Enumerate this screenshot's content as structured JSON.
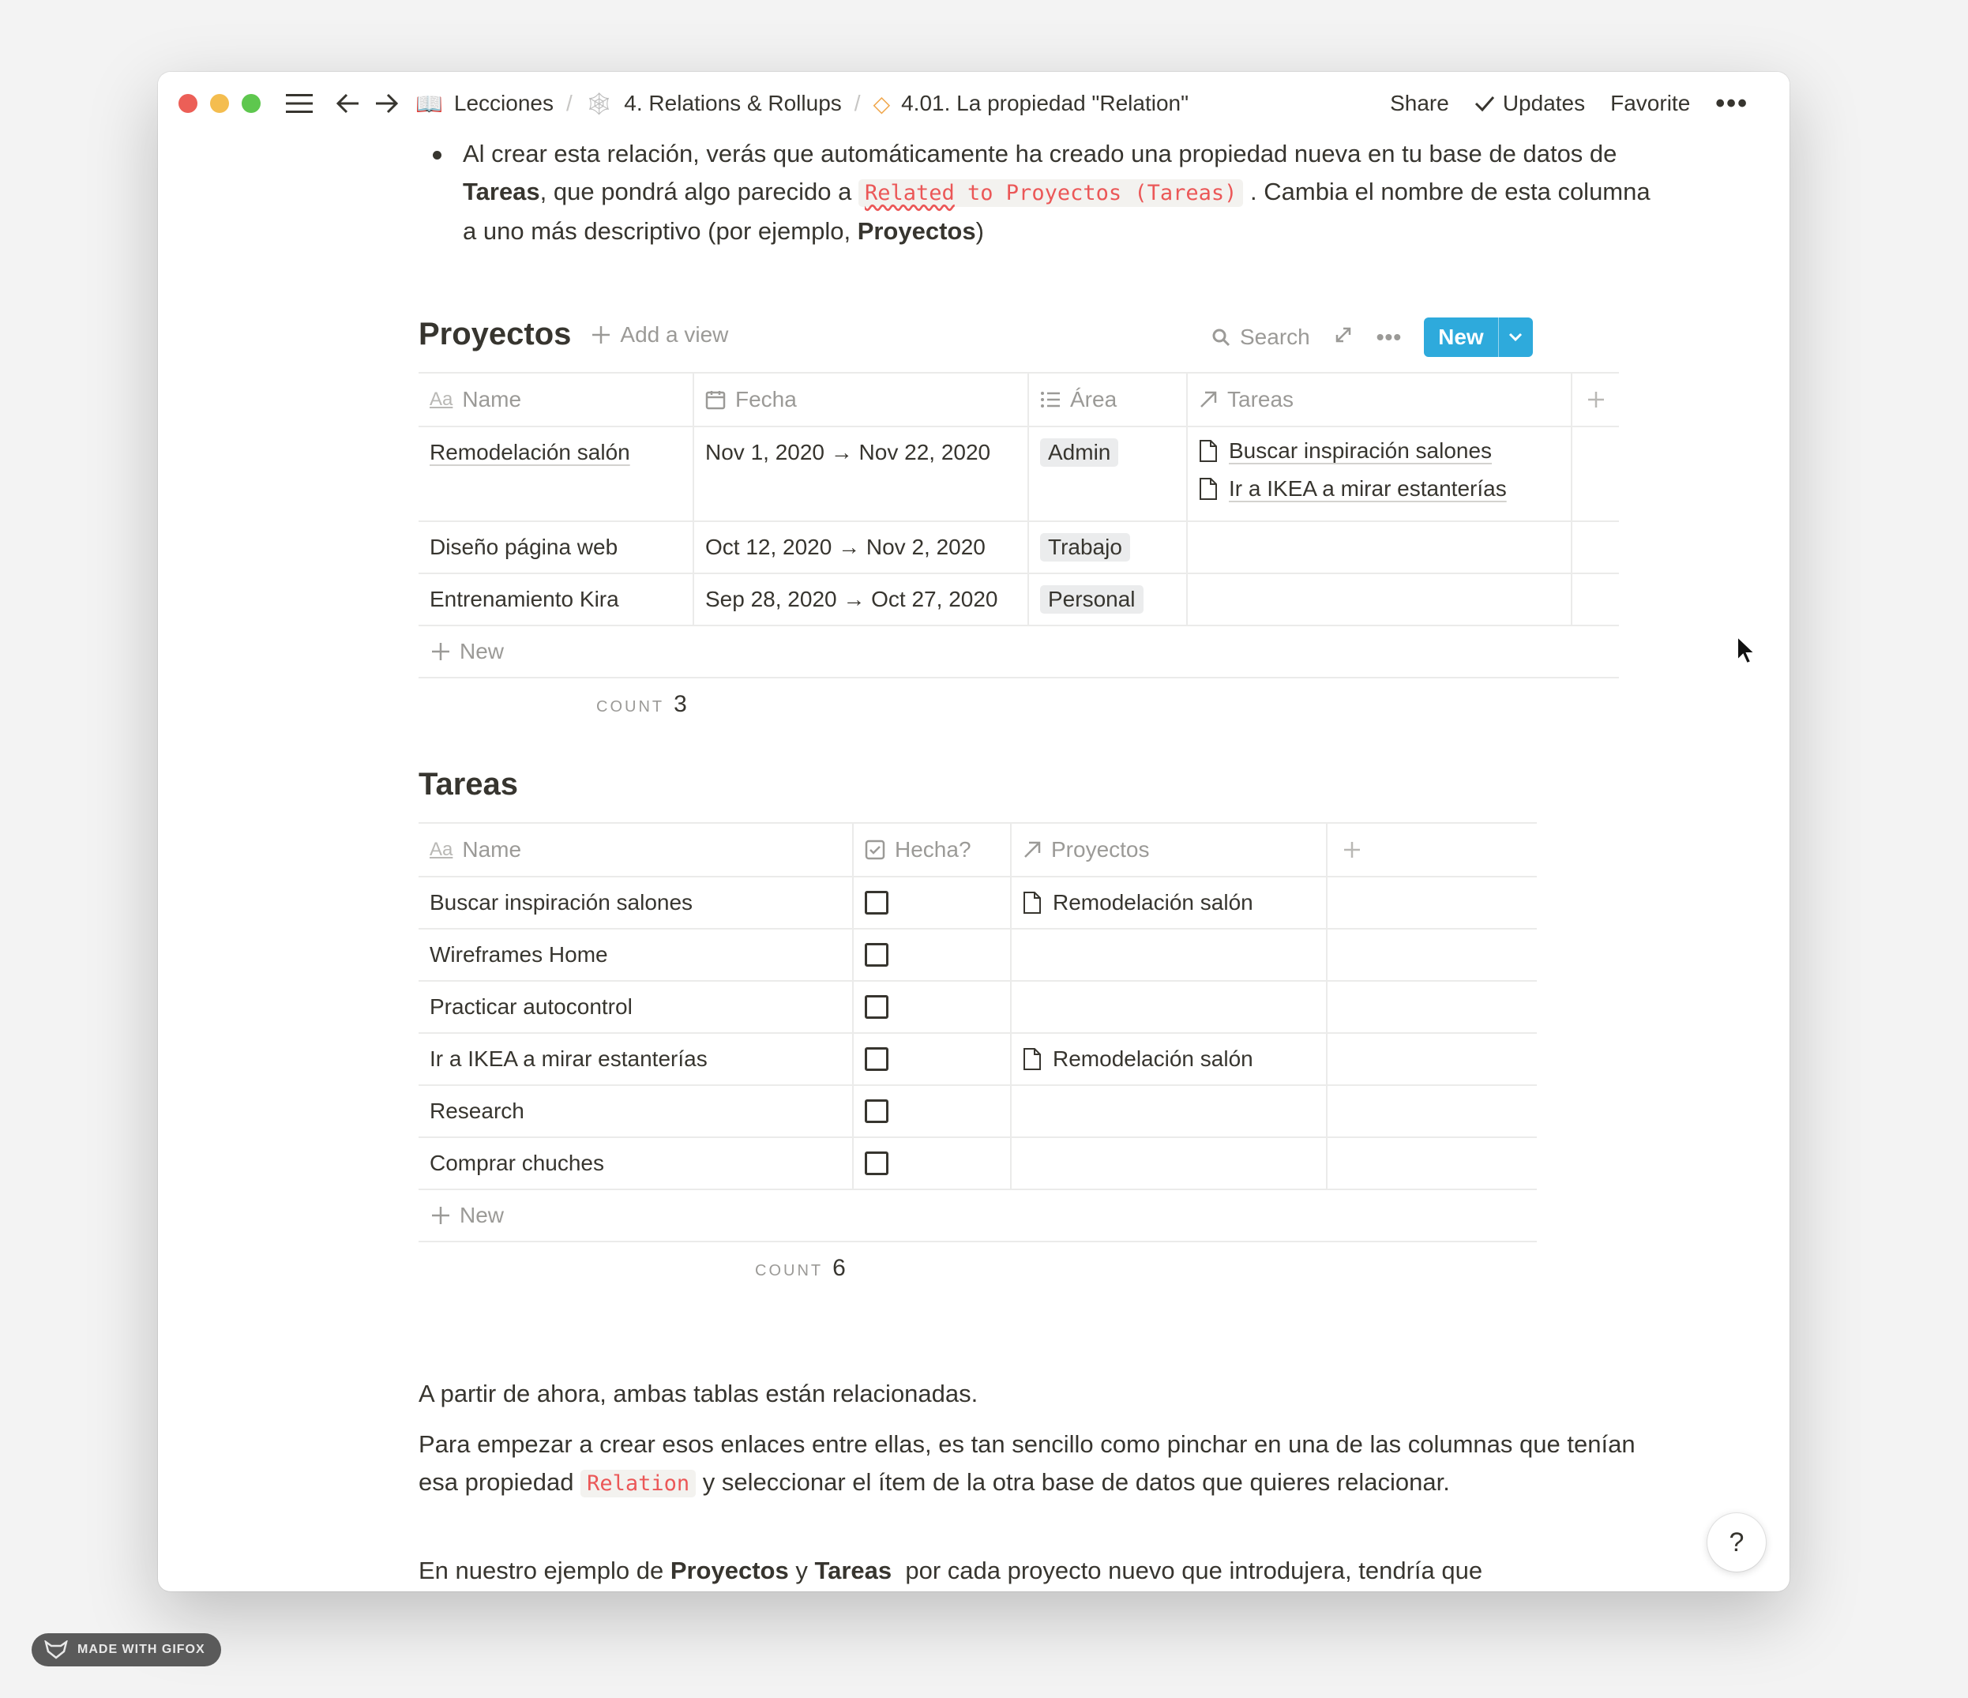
{
  "topbar": {
    "breadcrumbs": [
      {
        "icon": "📖",
        "label": "Lecciones"
      },
      {
        "icon": "🕸",
        "label": "4. Relations & Rollups"
      },
      {
        "icon": "◇",
        "label": "4.01. La propiedad \"Relation\""
      }
    ],
    "share": "Share",
    "updates": "Updates",
    "favorite": "Favorite",
    "more": "•••"
  },
  "intro": {
    "t1": "Al crear esta relación, verás que automáticamente ha creado una propiedad nueva en tu base de datos de ",
    "b1": "Tareas",
    "t2": ", que pondrá algo parecido a ",
    "code_a": "Related",
    "code_b": " to Proyectos (Tareas)",
    "t3": " . Cambia el nombre de esta columna a uno más descriptivo (por ejemplo, ",
    "b2": "Proyectos",
    "t4": ")"
  },
  "proyectos": {
    "title": "Proyectos",
    "add_view": "Add a view",
    "search": "Search",
    "new_button": "New",
    "columns": {
      "name": "Name",
      "fecha": "Fecha",
      "area": "Área",
      "tareas": "Tareas",
      "name_icon": "Aa"
    },
    "rows": [
      {
        "name": "Remodelación salón",
        "fecha": "Nov 1, 2020 → Nov 22, 2020",
        "area": "Admin",
        "tareas": [
          "Buscar inspiración salones",
          "Ir a IKEA a mirar estanterías"
        ]
      },
      {
        "name": "Diseño página web",
        "fecha": "Oct 12, 2020 → Nov 2, 2020",
        "area": "Trabajo",
        "tareas": []
      },
      {
        "name": "Entrenamiento Kira",
        "fecha": "Sep 28, 2020 → Oct 27, 2020",
        "area": "Personal",
        "tareas": []
      }
    ],
    "new_row": "New",
    "count_label": "COUNT",
    "count_value": "3"
  },
  "tareas": {
    "title": "Tareas",
    "columns": {
      "name": "Name",
      "hecha": "Hecha?",
      "proyectos": "Proyectos",
      "name_icon": "Aa"
    },
    "rows": [
      {
        "name": "Buscar inspiración salones",
        "hecha": false,
        "proyectos": "Remodelación salón"
      },
      {
        "name": "Wireframes Home",
        "hecha": false,
        "proyectos": ""
      },
      {
        "name": "Practicar autocontrol",
        "hecha": false,
        "proyectos": ""
      },
      {
        "name": "Ir a IKEA a mirar estanterías",
        "hecha": false,
        "proyectos": "Remodelación salón"
      },
      {
        "name": "Research",
        "hecha": false,
        "proyectos": ""
      },
      {
        "name": "Comprar chuches",
        "hecha": false,
        "proyectos": ""
      }
    ],
    "new_row": "New",
    "count_label": "COUNT",
    "count_value": "6"
  },
  "body": {
    "p1": "A partir de ahora, ambas tablas están relacionadas.",
    "p2a": "Para empezar a crear esos enlaces entre ellas, es tan sencillo como pinchar en una de las columnas que tenían esa propiedad ",
    "p2code": "Relation",
    "p2b": " y seleccionar el ítem de la otra base de datos que quieres relacionar.",
    "p3a": "En nuestro ejemplo de ",
    "p3b1": "Proyectos",
    "p3mid": " y ",
    "p3b2": "Tareas",
    "p3c": "  por cada proyecto nuevo que introdujera, tendría que"
  },
  "help": "?",
  "gifox": "MADE WITH GIFOX",
  "colors": {
    "accent": "#2eaadc",
    "code": "#eb5757",
    "muted": "#9b9a97",
    "text": "#37352f"
  }
}
